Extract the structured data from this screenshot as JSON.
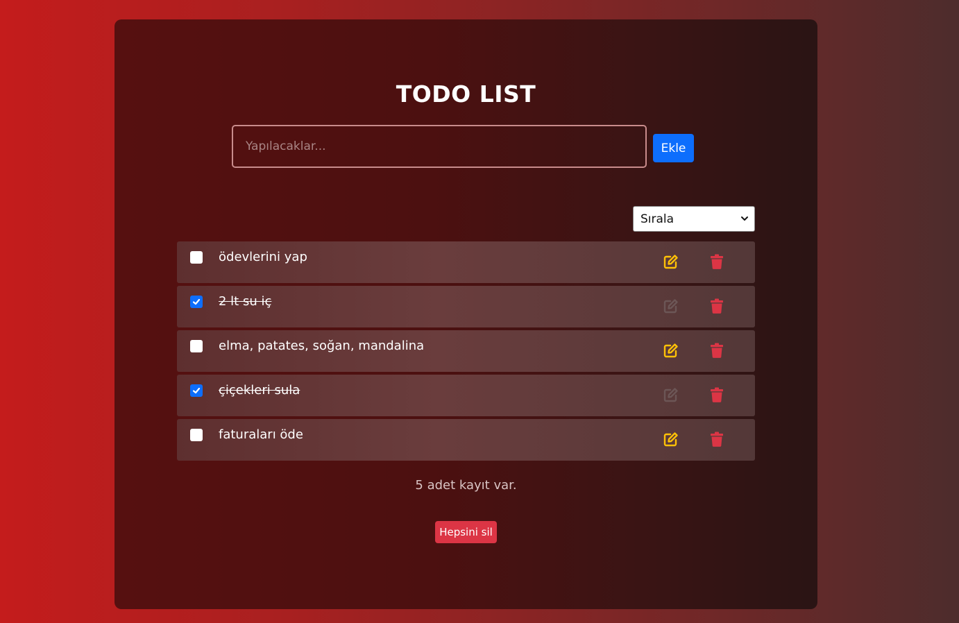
{
  "header": {
    "title": "TODO LIST"
  },
  "form": {
    "placeholder": "Yapılacaklar...",
    "value": "",
    "add_label": "Ekle"
  },
  "sort": {
    "selected": "Sırala"
  },
  "todos": [
    {
      "text": "ödevlerini yap",
      "done": false
    },
    {
      "text": "2 lt su iç",
      "done": true
    },
    {
      "text": "elma, patates, soğan, mandalina",
      "done": false
    },
    {
      "text": "çiçekleri sula",
      "done": true
    },
    {
      "text": "faturaları öde",
      "done": false
    }
  ],
  "footer": {
    "count_text": "5 adet kayıt var.",
    "clear_label": "Hepsini sil"
  },
  "colors": {
    "edit_active": "#ffc107",
    "edit_disabled": "#6c5656",
    "delete": "#dc3545",
    "primary": "#0d6efd"
  }
}
